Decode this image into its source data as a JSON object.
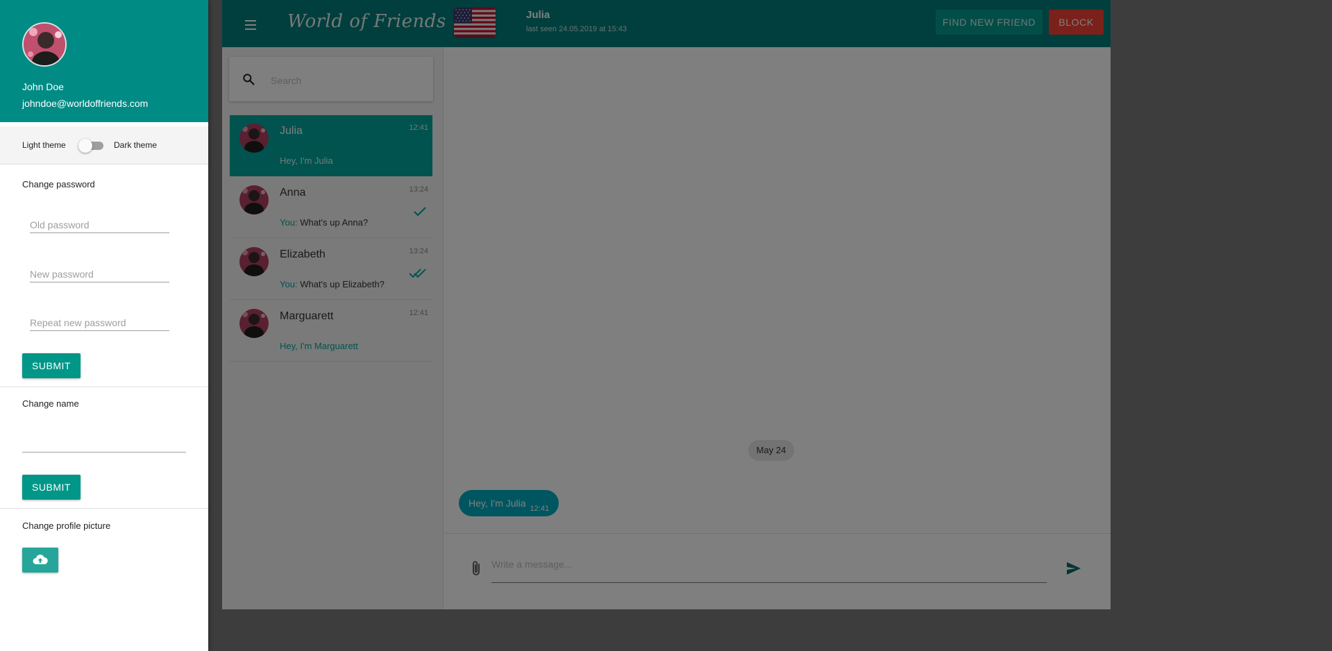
{
  "app": {
    "logo": "World of Friends",
    "contact": {
      "name": "Julia",
      "last_seen": "last seen 24.05.2019 at 15:43"
    },
    "find_label": "FIND NEW FRIEND",
    "block_label": "BLOCK"
  },
  "search": {
    "placeholder": "Search"
  },
  "chats": [
    {
      "name": "Julia",
      "time": "12:41",
      "message": "Hey, I'm Julia",
      "active": true
    },
    {
      "name": "Anna",
      "time": "13:24",
      "you_prefix": "You:",
      "message": "What's up Anna?",
      "status": "sent-check"
    },
    {
      "name": "Elizabeth",
      "time": "13:24",
      "you_prefix": "You:",
      "message": "What's up Elizabeth?",
      "status": "read-double-check"
    },
    {
      "name": "Marguarett",
      "time": "12:41",
      "message": "Hey, I'm Marguarett"
    }
  ],
  "conversation": {
    "date_chip": "May 24",
    "messages": [
      {
        "text": "Hey, I'm Julia",
        "time": "12:41"
      }
    ],
    "composer_placeholder": "Write a message..."
  },
  "drawer": {
    "user": {
      "name": "John Doe",
      "email": "johndoe@worldoffriends.com"
    },
    "theme": {
      "light_label": "Light theme",
      "dark_label": "Dark theme",
      "dark_enabled": false
    },
    "change_password": {
      "title": "Change password",
      "old_placeholder": "Old password",
      "new_placeholder": "New password",
      "repeat_placeholder": "Repeat new password",
      "submit_label": "SUBMIT"
    },
    "change_name": {
      "title": "Change name",
      "submit_label": "SUBMIT"
    },
    "change_picture": {
      "title": "Change profile picture",
      "upload_icon": "cloud-upload-icon"
    }
  },
  "colors": {
    "primary": "#008b85",
    "topbar": "#007e7a",
    "active_chat": "#00a79d",
    "bubble": "#00acc1",
    "block": "#f44336",
    "submit": "#009688"
  }
}
